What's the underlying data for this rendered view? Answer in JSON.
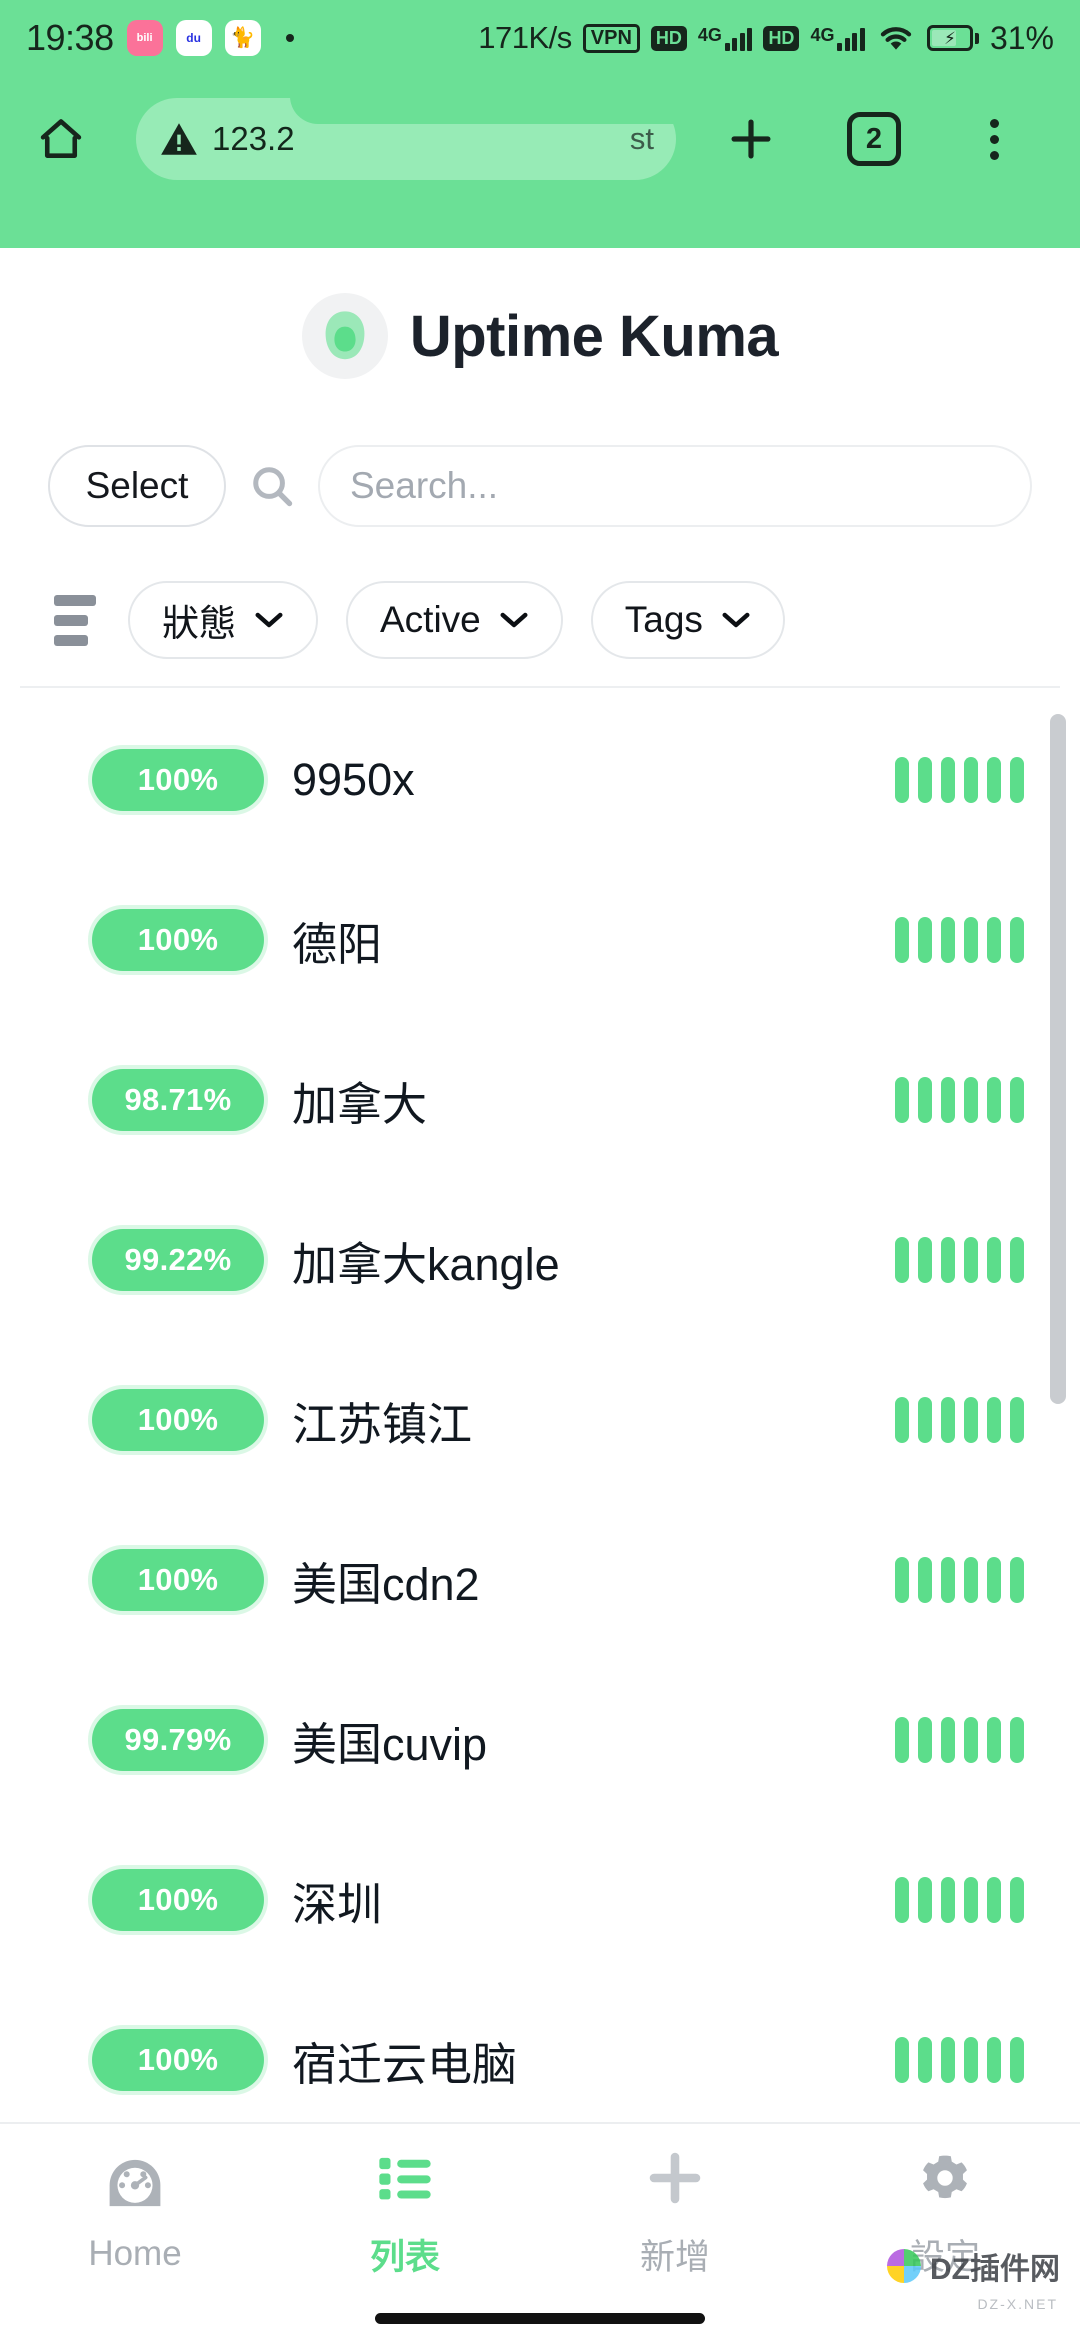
{
  "statusbar": {
    "time": "19:38",
    "app_icons": [
      {
        "name": "bilibili-icon",
        "glyph": "bili"
      },
      {
        "name": "baidu-icon",
        "glyph": "du"
      },
      {
        "name": "cat-app-icon",
        "glyph": "●"
      }
    ],
    "network_speed": "171K/s",
    "vpn_label": "VPN",
    "hd_label_1": "HD",
    "gen_label_1": "4G",
    "hd_label_2": "HD",
    "gen_label_2": "4G",
    "battery_percent": "31%"
  },
  "toolbar": {
    "home_icon": "home-icon",
    "security_icon": "warning-triangle-icon",
    "url_text": "123.2",
    "url_suffix": "st",
    "new_tab_label": "+",
    "tab_count": "2",
    "menu_icon": "kebab-menu-icon"
  },
  "header": {
    "logo_name": "uptime-kuma-logo",
    "title": "Uptime Kuma"
  },
  "search": {
    "select_label": "Select",
    "search_icon": "search-icon",
    "placeholder": "Search...",
    "value": ""
  },
  "filters": {
    "list_toggle_icon": "list-view-toggle-icon",
    "pills": [
      {
        "label": "狀態",
        "chevron": "⌄"
      },
      {
        "label": "Active",
        "chevron": "⌄"
      },
      {
        "label": "Tags",
        "chevron": "⌄"
      }
    ]
  },
  "monitors": [
    {
      "uptime": "100%",
      "name": "9950x",
      "beats": 6
    },
    {
      "uptime": "100%",
      "name": "德阳",
      "beats": 6
    },
    {
      "uptime": "98.71%",
      "name": "加拿大",
      "beats": 6
    },
    {
      "uptime": "99.22%",
      "name": "加拿大kangle",
      "beats": 6
    },
    {
      "uptime": "100%",
      "name": "江苏镇江",
      "beats": 6
    },
    {
      "uptime": "100%",
      "name": "美国cdn2",
      "beats": 6
    },
    {
      "uptime": "99.79%",
      "name": "美国cuvip",
      "beats": 6
    },
    {
      "uptime": "100%",
      "name": "深圳",
      "beats": 6
    },
    {
      "uptime": "100%",
      "name": "宿迁云电脑",
      "beats": 6
    }
  ],
  "bottom_nav": [
    {
      "label": "Home",
      "icon": "dashboard-icon",
      "active": false
    },
    {
      "label": "列表",
      "icon": "list-icon",
      "active": true
    },
    {
      "label": "新增",
      "icon": "plus-icon",
      "active": false
    },
    {
      "label": "設定",
      "icon": "gear-icon",
      "active": false
    }
  ],
  "watermark": {
    "text": "DZ插件网",
    "sub": "DZ-X.NET"
  },
  "colors": {
    "chrome_green": "#6BE096",
    "accent_green": "#5CDD8B",
    "url_bar": "#97EBB6",
    "text_dark": "#111820",
    "muted": "#A9AEB4"
  }
}
